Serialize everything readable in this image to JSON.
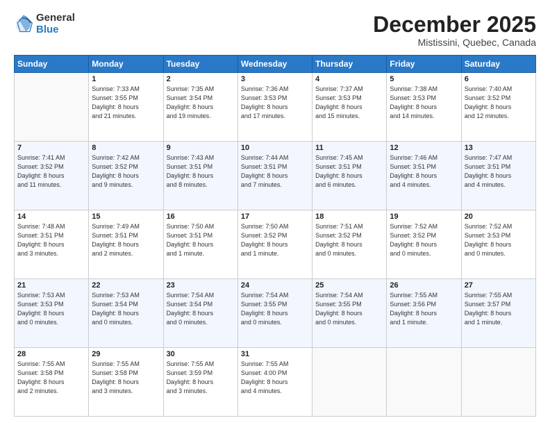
{
  "logo": {
    "general": "General",
    "blue": "Blue"
  },
  "header": {
    "title": "December 2025",
    "subtitle": "Mistissini, Quebec, Canada"
  },
  "columns": [
    "Sunday",
    "Monday",
    "Tuesday",
    "Wednesday",
    "Thursday",
    "Friday",
    "Saturday"
  ],
  "weeks": [
    [
      {
        "day": "",
        "info": ""
      },
      {
        "day": "1",
        "info": "Sunrise: 7:33 AM\nSunset: 3:55 PM\nDaylight: 8 hours\nand 21 minutes."
      },
      {
        "day": "2",
        "info": "Sunrise: 7:35 AM\nSunset: 3:54 PM\nDaylight: 8 hours\nand 19 minutes."
      },
      {
        "day": "3",
        "info": "Sunrise: 7:36 AM\nSunset: 3:53 PM\nDaylight: 8 hours\nand 17 minutes."
      },
      {
        "day": "4",
        "info": "Sunrise: 7:37 AM\nSunset: 3:53 PM\nDaylight: 8 hours\nand 15 minutes."
      },
      {
        "day": "5",
        "info": "Sunrise: 7:38 AM\nSunset: 3:53 PM\nDaylight: 8 hours\nand 14 minutes."
      },
      {
        "day": "6",
        "info": "Sunrise: 7:40 AM\nSunset: 3:52 PM\nDaylight: 8 hours\nand 12 minutes."
      }
    ],
    [
      {
        "day": "7",
        "info": "Sunrise: 7:41 AM\nSunset: 3:52 PM\nDaylight: 8 hours\nand 11 minutes."
      },
      {
        "day": "8",
        "info": "Sunrise: 7:42 AM\nSunset: 3:52 PM\nDaylight: 8 hours\nand 9 minutes."
      },
      {
        "day": "9",
        "info": "Sunrise: 7:43 AM\nSunset: 3:51 PM\nDaylight: 8 hours\nand 8 minutes."
      },
      {
        "day": "10",
        "info": "Sunrise: 7:44 AM\nSunset: 3:51 PM\nDaylight: 8 hours\nand 7 minutes."
      },
      {
        "day": "11",
        "info": "Sunrise: 7:45 AM\nSunset: 3:51 PM\nDaylight: 8 hours\nand 6 minutes."
      },
      {
        "day": "12",
        "info": "Sunrise: 7:46 AM\nSunset: 3:51 PM\nDaylight: 8 hours\nand 4 minutes."
      },
      {
        "day": "13",
        "info": "Sunrise: 7:47 AM\nSunset: 3:51 PM\nDaylight: 8 hours\nand 4 minutes."
      }
    ],
    [
      {
        "day": "14",
        "info": "Sunrise: 7:48 AM\nSunset: 3:51 PM\nDaylight: 8 hours\nand 3 minutes."
      },
      {
        "day": "15",
        "info": "Sunrise: 7:49 AM\nSunset: 3:51 PM\nDaylight: 8 hours\nand 2 minutes."
      },
      {
        "day": "16",
        "info": "Sunrise: 7:50 AM\nSunset: 3:51 PM\nDaylight: 8 hours\nand 1 minute."
      },
      {
        "day": "17",
        "info": "Sunrise: 7:50 AM\nSunset: 3:52 PM\nDaylight: 8 hours\nand 1 minute."
      },
      {
        "day": "18",
        "info": "Sunrise: 7:51 AM\nSunset: 3:52 PM\nDaylight: 8 hours\nand 0 minutes."
      },
      {
        "day": "19",
        "info": "Sunrise: 7:52 AM\nSunset: 3:52 PM\nDaylight: 8 hours\nand 0 minutes."
      },
      {
        "day": "20",
        "info": "Sunrise: 7:52 AM\nSunset: 3:53 PM\nDaylight: 8 hours\nand 0 minutes."
      }
    ],
    [
      {
        "day": "21",
        "info": "Sunrise: 7:53 AM\nSunset: 3:53 PM\nDaylight: 8 hours\nand 0 minutes."
      },
      {
        "day": "22",
        "info": "Sunrise: 7:53 AM\nSunset: 3:54 PM\nDaylight: 8 hours\nand 0 minutes."
      },
      {
        "day": "23",
        "info": "Sunrise: 7:54 AM\nSunset: 3:54 PM\nDaylight: 8 hours\nand 0 minutes."
      },
      {
        "day": "24",
        "info": "Sunrise: 7:54 AM\nSunset: 3:55 PM\nDaylight: 8 hours\nand 0 minutes."
      },
      {
        "day": "25",
        "info": "Sunrise: 7:54 AM\nSunset: 3:55 PM\nDaylight: 8 hours\nand 0 minutes."
      },
      {
        "day": "26",
        "info": "Sunrise: 7:55 AM\nSunset: 3:56 PM\nDaylight: 8 hours\nand 1 minute."
      },
      {
        "day": "27",
        "info": "Sunrise: 7:55 AM\nSunset: 3:57 PM\nDaylight: 8 hours\nand 1 minute."
      }
    ],
    [
      {
        "day": "28",
        "info": "Sunrise: 7:55 AM\nSunset: 3:58 PM\nDaylight: 8 hours\nand 2 minutes."
      },
      {
        "day": "29",
        "info": "Sunrise: 7:55 AM\nSunset: 3:58 PM\nDaylight: 8 hours\nand 3 minutes."
      },
      {
        "day": "30",
        "info": "Sunrise: 7:55 AM\nSunset: 3:59 PM\nDaylight: 8 hours\nand 3 minutes."
      },
      {
        "day": "31",
        "info": "Sunrise: 7:55 AM\nSunset: 4:00 PM\nDaylight: 8 hours\nand 4 minutes."
      },
      {
        "day": "",
        "info": ""
      },
      {
        "day": "",
        "info": ""
      },
      {
        "day": "",
        "info": ""
      }
    ]
  ]
}
